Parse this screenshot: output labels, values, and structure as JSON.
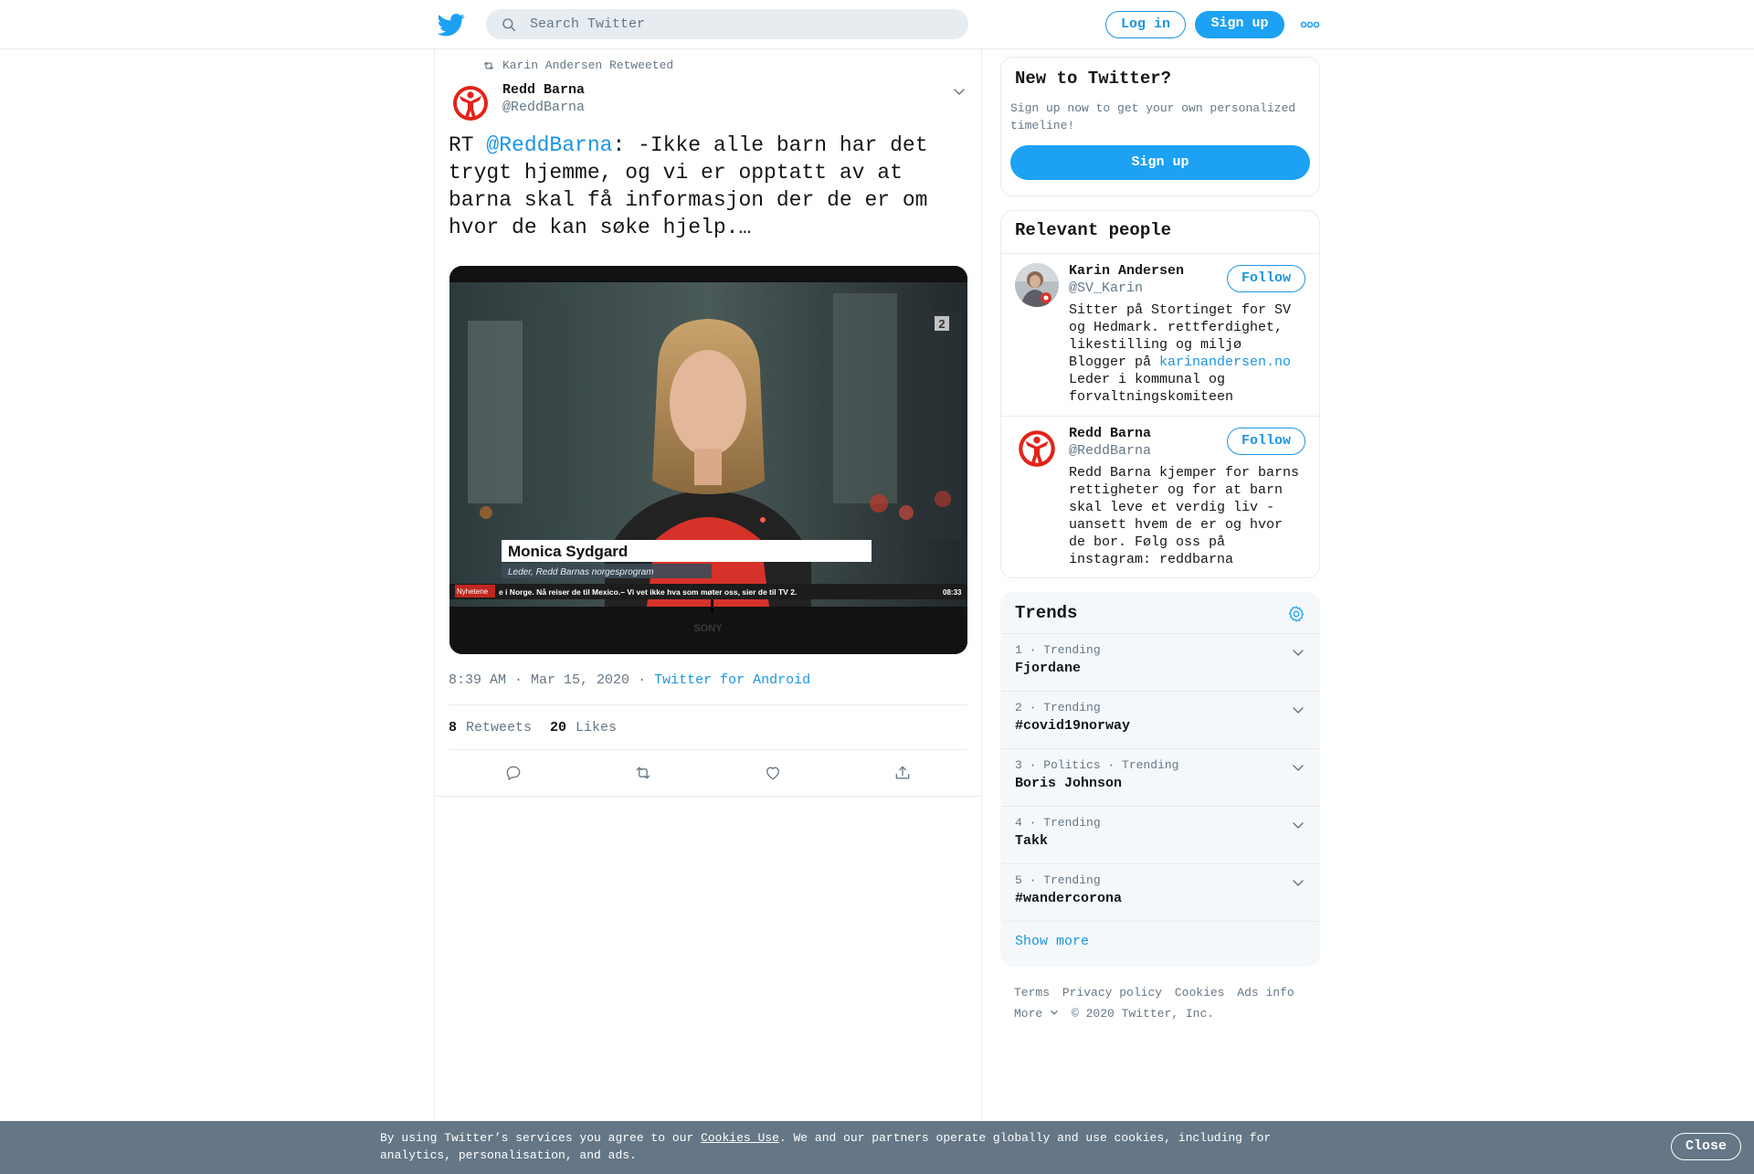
{
  "header": {
    "search_placeholder": "Search Twitter",
    "login_label": "Log in",
    "signup_label": "Sign up"
  },
  "tweet": {
    "retweeted_by": "Karin Andersen Retweeted",
    "author_name": "Redd Barna",
    "author_handle": "@ReddBarna",
    "text_prefix": "RT ",
    "text_mention": "@ReddBarna",
    "text_body": ": -Ikke alle barn har det trygt hjemme, og vi er opptatt av at barna skal få informasjon der de er om hvor de kan søke hjelp.…",
    "media": {
      "lower_third_name": "Monica Sydgard",
      "lower_third_title": "Leder, Redd Barnas norgesprogram",
      "ticker_label": "Nyhetene",
      "ticker_text": "e i Norge. Nå reiser de til Mexico.– Vi vet ikke hva som møter oss, sier de til TV 2.",
      "ticker_time": "08:33",
      "channel_logo": "2",
      "tv_brand": "SONY"
    },
    "timestamp": "8:39 AM · Mar 15, 2020",
    "separator": "·",
    "source": "Twitter for Android",
    "retweets_count": "8",
    "retweets_label": "Retweets",
    "likes_count": "20",
    "likes_label": "Likes"
  },
  "sidebar": {
    "new_to_twitter": {
      "title": "New to Twitter?",
      "subtitle": "Sign up now to get your own personalized timeline!",
      "signup_label": "Sign up"
    },
    "relevant_people": {
      "title": "Relevant people",
      "people": [
        {
          "name": "Karin Andersen",
          "handle": "@SV_Karin",
          "bio_before_link": "Sitter på Stortinget for SV og Hedmark. rettferdighet, likestilling og miljø Blogger på ",
          "bio_link": "karinandersen.no",
          "bio_after_link": " Leder i kommunal og forvaltningskomiteen",
          "follow_label": "Follow"
        },
        {
          "name": "Redd Barna",
          "handle": "@ReddBarna",
          "bio": "Redd Barna kjemper for barns rettigheter og for at barn skal leve et verdig liv - uansett hvem de er og hvor de bor. Følg oss på instagram: reddbarna",
          "follow_label": "Follow"
        }
      ]
    },
    "trends": {
      "title": "Trends",
      "items": [
        {
          "meta": "1 · Trending",
          "name": "Fjordane"
        },
        {
          "meta": "2 · Trending",
          "name": "#covid19norway"
        },
        {
          "meta": "3 · Politics · Trending",
          "name": "Boris Johnson"
        },
        {
          "meta": "4 · Trending",
          "name": "Takk"
        },
        {
          "meta": "5 · Trending",
          "name": "#wandercorona"
        }
      ],
      "show_more": "Show more"
    },
    "footer": {
      "terms": "Terms",
      "privacy": "Privacy policy",
      "cookies": "Cookies",
      "ads": "Ads info",
      "more": "More",
      "copyright": "© 2020 Twitter, Inc."
    }
  },
  "cookie_bar": {
    "text_before": "By using Twitter’s services you agree to our ",
    "link": "Cookies Use",
    "text_after": ". We and our partners operate globally and use cookies, including for analytics, personalisation, and ads.",
    "close_label": "Close"
  },
  "colors": {
    "brand_blue": "#1da1f2",
    "link_blue": "#1b95e0",
    "muted": "#657786",
    "redd_barna_red": "#e2231a"
  }
}
